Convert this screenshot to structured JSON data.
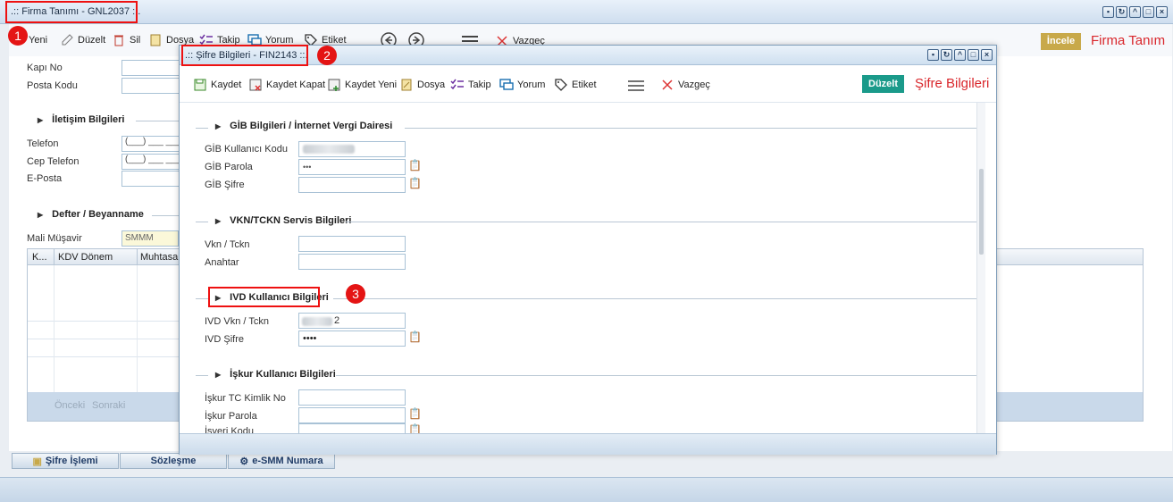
{
  "outer_window": {
    "title": ".:: Firma Tanımı - GNL2037 ::.",
    "toolbar": {
      "new_label": "Yeni",
      "edit_label": "Düzelt",
      "delete_label": "Sil",
      "file_label": "Dosya",
      "track_label": "Takip",
      "comment_label": "Yorum",
      "tag_label": "Etiket",
      "cancel_label": "Vazgeç",
      "inspect_label": "İncele",
      "page_heading": "Firma Tanım"
    },
    "fields": {
      "door_no": "Kapı No",
      "postal_code": "Posta Kodu"
    },
    "contact_section": {
      "title": "İletişim Bilgileri",
      "phone": "Telefon",
      "mobile": "Cep Telefon",
      "email": "E-Posta",
      "phone_mask": "(___) ___ ___",
      "mobile_mask": "(___) ___ ___"
    },
    "ledger_section": {
      "title": "Defter / Beyanname",
      "accountant_label": "Mali Müşavir",
      "accountant_value": "SMMM",
      "grid_headers": [
        "K...",
        "KDV Dönem",
        "Muhtasar"
      ],
      "prev_label": "Önceki",
      "next_label": "Sonraki"
    },
    "bottom_tabs": [
      "Şifre İşlemi",
      "Sözleşme",
      "e-SMM Numara"
    ]
  },
  "modal": {
    "title": ".:: Şifre Bilgileri - FIN2143 ::.",
    "toolbar": {
      "save_label": "Kaydet",
      "save_close_label": "Kaydet Kapat",
      "save_new_label": "Kaydet Yeni",
      "file_label": "Dosya",
      "track_label": "Takip",
      "comment_label": "Yorum",
      "tag_label": "Etiket",
      "cancel_label": "Vazgeç",
      "edit_button": "Düzelt",
      "heading": "Şifre Bilgileri"
    },
    "gib_section": {
      "title": "GİB Bilgileri / İnternet Vergi Dairesi",
      "user_code_label": "GİB Kullanıcı Kodu",
      "password_label": "GİB Parola",
      "password_value": "•••",
      "cipher_label": "GİB Şifre"
    },
    "vkn_section": {
      "title": "VKN/TCKN Servis Bilgileri",
      "vkn_label": "Vkn / Tckn",
      "key_label": "Anahtar"
    },
    "ivd_section": {
      "title": "IVD Kullanıcı Bilgileri",
      "vkn_label": "IVD Vkn / Tckn",
      "vkn_value_tail": "2",
      "password_label": "IVD Şifre",
      "password_value": "••••"
    },
    "iskur_section": {
      "title": "İşkur Kullanıcı Bilgileri",
      "tc_label": "İşkur TC Kimlik No",
      "password_label": "İşkur Parola",
      "employer_code_label": "İşveri Kodu"
    }
  },
  "annotations": [
    "1",
    "2",
    "3"
  ],
  "colors": {
    "annotation_red": "#e41414",
    "heading_red": "#d9262b",
    "edit_button_teal": "#1a9a8a",
    "inspect_gold": "#c8a94a"
  }
}
